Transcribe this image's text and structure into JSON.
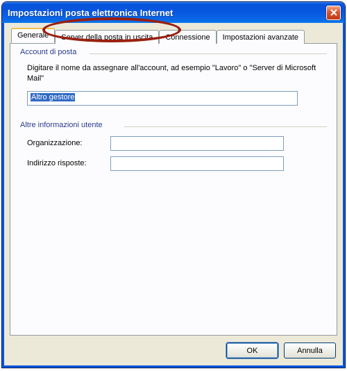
{
  "window": {
    "title": "Impostazioni posta elettronica Internet"
  },
  "tabs": {
    "generale": "Generale",
    "server_uscita": "Server della posta in uscita",
    "connessione": "Connessione",
    "avanzate": "Impostazioni avanzate"
  },
  "account_group": {
    "legend": "Account di posta",
    "help": "Digitare il nome da assegnare all'account, ad esempio \"Lavoro\" o \"Server di Microsoft Mail\"",
    "value": "Altro gestore"
  },
  "info_group": {
    "legend": "Altre informazioni utente",
    "org_label": "Organizzazione:",
    "org_value": "",
    "reply_label": "Indirizzo risposte:",
    "reply_value": ""
  },
  "buttons": {
    "ok": "OK",
    "cancel": "Annulla"
  }
}
